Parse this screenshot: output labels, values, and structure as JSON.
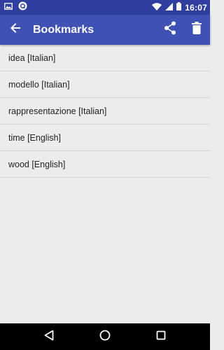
{
  "status_bar": {
    "time": "16:07",
    "icons": [
      "image-icon",
      "app-notification-icon",
      "wifi-icon",
      "signal-icon",
      "battery-icon"
    ]
  },
  "app_bar": {
    "title": "Bookmarks",
    "back_icon": "arrow-back-icon",
    "actions": [
      "share-icon",
      "delete-icon"
    ]
  },
  "bookmarks": [
    {
      "label": "idea [Italian]"
    },
    {
      "label": "modello [Italian]"
    },
    {
      "label": "rappresentazione [Italian]"
    },
    {
      "label": "time [English]"
    },
    {
      "label": "wood [English]"
    }
  ],
  "nav_bar": {
    "buttons": [
      "back-triangle-icon",
      "home-circle-icon",
      "recents-square-icon"
    ]
  },
  "colors": {
    "primary": "#3f51b5",
    "primary_dark": "#303f9f",
    "background": "#ececec",
    "divider": "#d4d4d4"
  }
}
